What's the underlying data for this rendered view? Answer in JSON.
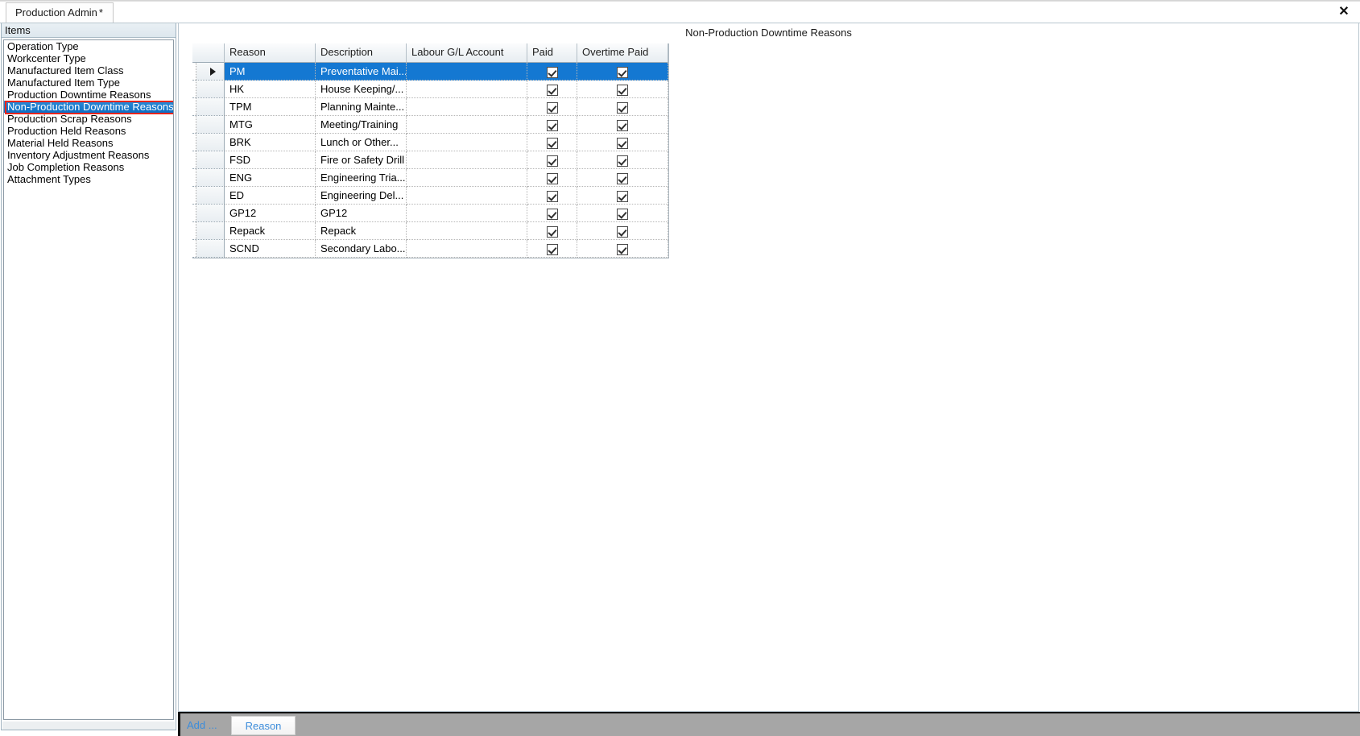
{
  "window": {
    "tab_label": "Production Admin",
    "tab_dirty_marker": "*",
    "close_icon": "close-icon"
  },
  "sidebar": {
    "header": "Items",
    "items": [
      {
        "label": "Operation Type",
        "selected": false
      },
      {
        "label": "Workcenter Type",
        "selected": false
      },
      {
        "label": "Manufactured Item Class",
        "selected": false
      },
      {
        "label": "Manufactured Item Type",
        "selected": false
      },
      {
        "label": "Production Downtime Reasons",
        "selected": false
      },
      {
        "label": "Non-Production Downtime Reasons",
        "selected": true
      },
      {
        "label": "Production Scrap Reasons",
        "selected": false
      },
      {
        "label": "Production Held Reasons",
        "selected": false
      },
      {
        "label": "Material Held Reasons",
        "selected": false
      },
      {
        "label": "Inventory Adjustment Reasons",
        "selected": false
      },
      {
        "label": "Job Completion Reasons",
        "selected": false
      },
      {
        "label": "Attachment Types",
        "selected": false
      }
    ]
  },
  "content": {
    "title": "Non-Production Downtime Reasons",
    "grid": {
      "columns": [
        "Reason",
        "Description",
        "Labour G/L Account",
        "Paid",
        "Overtime Paid"
      ],
      "rows": [
        {
          "reason": "PM",
          "description": "Preventative Mai...",
          "gl": "",
          "paid": true,
          "overtime_paid": true,
          "current": true
        },
        {
          "reason": "HK",
          "description": "House Keeping/...",
          "gl": "",
          "paid": true,
          "overtime_paid": true,
          "current": false
        },
        {
          "reason": "TPM",
          "description": "Planning Mainte...",
          "gl": "",
          "paid": true,
          "overtime_paid": true,
          "current": false
        },
        {
          "reason": "MTG",
          "description": "Meeting/Training",
          "gl": "",
          "paid": true,
          "overtime_paid": true,
          "current": false
        },
        {
          "reason": "BRK",
          "description": "Lunch or Other...",
          "gl": "",
          "paid": true,
          "overtime_paid": true,
          "current": false
        },
        {
          "reason": "FSD",
          "description": "Fire or Safety Drill",
          "gl": "",
          "paid": true,
          "overtime_paid": true,
          "current": false
        },
        {
          "reason": "ENG",
          "description": "Engineering Tria...",
          "gl": "",
          "paid": true,
          "overtime_paid": true,
          "current": false
        },
        {
          "reason": "ED",
          "description": "Engineering Del...",
          "gl": "",
          "paid": true,
          "overtime_paid": true,
          "current": false
        },
        {
          "reason": "GP12",
          "description": "GP12",
          "gl": "",
          "paid": true,
          "overtime_paid": true,
          "current": false
        },
        {
          "reason": "Repack",
          "description": "Repack",
          "gl": "",
          "paid": true,
          "overtime_paid": true,
          "current": false
        },
        {
          "reason": "SCND",
          "description": "Secondary Labo...",
          "gl": "",
          "paid": true,
          "overtime_paid": true,
          "current": false
        }
      ]
    }
  },
  "action_bar": {
    "add_label": "Add ...",
    "reason_button": "Reason"
  },
  "colors": {
    "selection_blue": "#1478d2",
    "sidebar_selection": "#0e6fc4",
    "annotation_red": "#e8241b",
    "link_blue": "#3d8ddb",
    "action_bar_gray": "#a6a6a6"
  }
}
